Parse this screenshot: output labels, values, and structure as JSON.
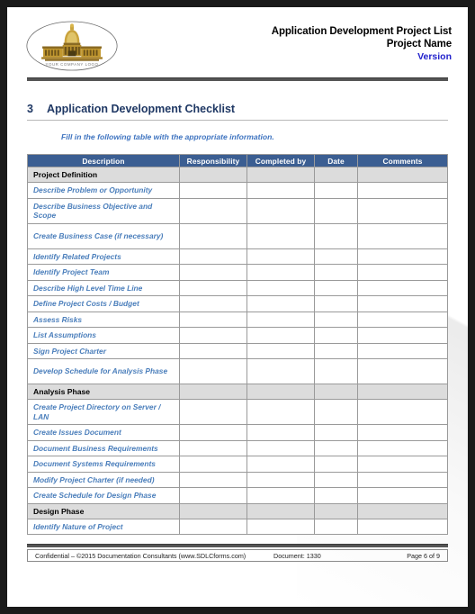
{
  "header": {
    "logo_caption": "YOUR COMPANY LOGO",
    "title": "Application Development Project List",
    "project_name": "Project Name",
    "version": "Version",
    "version_color": "#2222cc"
  },
  "section": {
    "number": "3",
    "title": "Application Development Checklist",
    "instruction": "Fill in the following table with the appropriate information.",
    "heading_color": "#1f3864",
    "instruction_color": "#3f74c0"
  },
  "table": {
    "header_bg": "#3b5e92",
    "group_bg": "#dcdcdc",
    "item_color": "#4a7ebb",
    "columns": [
      "Description",
      "Responsibility",
      "Completed by",
      "Date",
      "Comments"
    ],
    "rows": [
      {
        "type": "group",
        "description": "Project Definition"
      },
      {
        "type": "item",
        "description": "Describe Problem or Opportunity"
      },
      {
        "type": "item",
        "description": "Describe Business Objective and Scope",
        "tall": true
      },
      {
        "type": "item",
        "description": "Create Business Case (if necessary)",
        "tall": true
      },
      {
        "type": "item",
        "description": "Identify Related Projects"
      },
      {
        "type": "item",
        "description": "Identify Project Team"
      },
      {
        "type": "item",
        "description": "Describe High Level Time Line"
      },
      {
        "type": "item",
        "description": "Define Project Costs / Budget"
      },
      {
        "type": "item",
        "description": "Assess Risks"
      },
      {
        "type": "item",
        "description": "List Assumptions"
      },
      {
        "type": "item",
        "description": "Sign Project Charter"
      },
      {
        "type": "item",
        "description": "Develop Schedule for Analysis Phase",
        "tall": true
      },
      {
        "type": "group",
        "description": "Analysis Phase"
      },
      {
        "type": "item",
        "description": "Create Project Directory on Server / LAN",
        "tall": true
      },
      {
        "type": "item",
        "description": "Create Issues Document"
      },
      {
        "type": "item",
        "description": "Document Business Requirements"
      },
      {
        "type": "item",
        "description": "Document Systems Requirements"
      },
      {
        "type": "item",
        "description": "Modify Project Charter (if needed)"
      },
      {
        "type": "item",
        "description": "Create Schedule for Design Phase"
      },
      {
        "type": "group",
        "description": "Design Phase"
      },
      {
        "type": "item",
        "description": "Identify Nature of Project"
      }
    ]
  },
  "footer": {
    "confidential": "Confidential – ©2015 Documentation Consultants (www.SDLCforms.com)",
    "document": "Document: 1330",
    "page": "Page 6 of 9"
  }
}
